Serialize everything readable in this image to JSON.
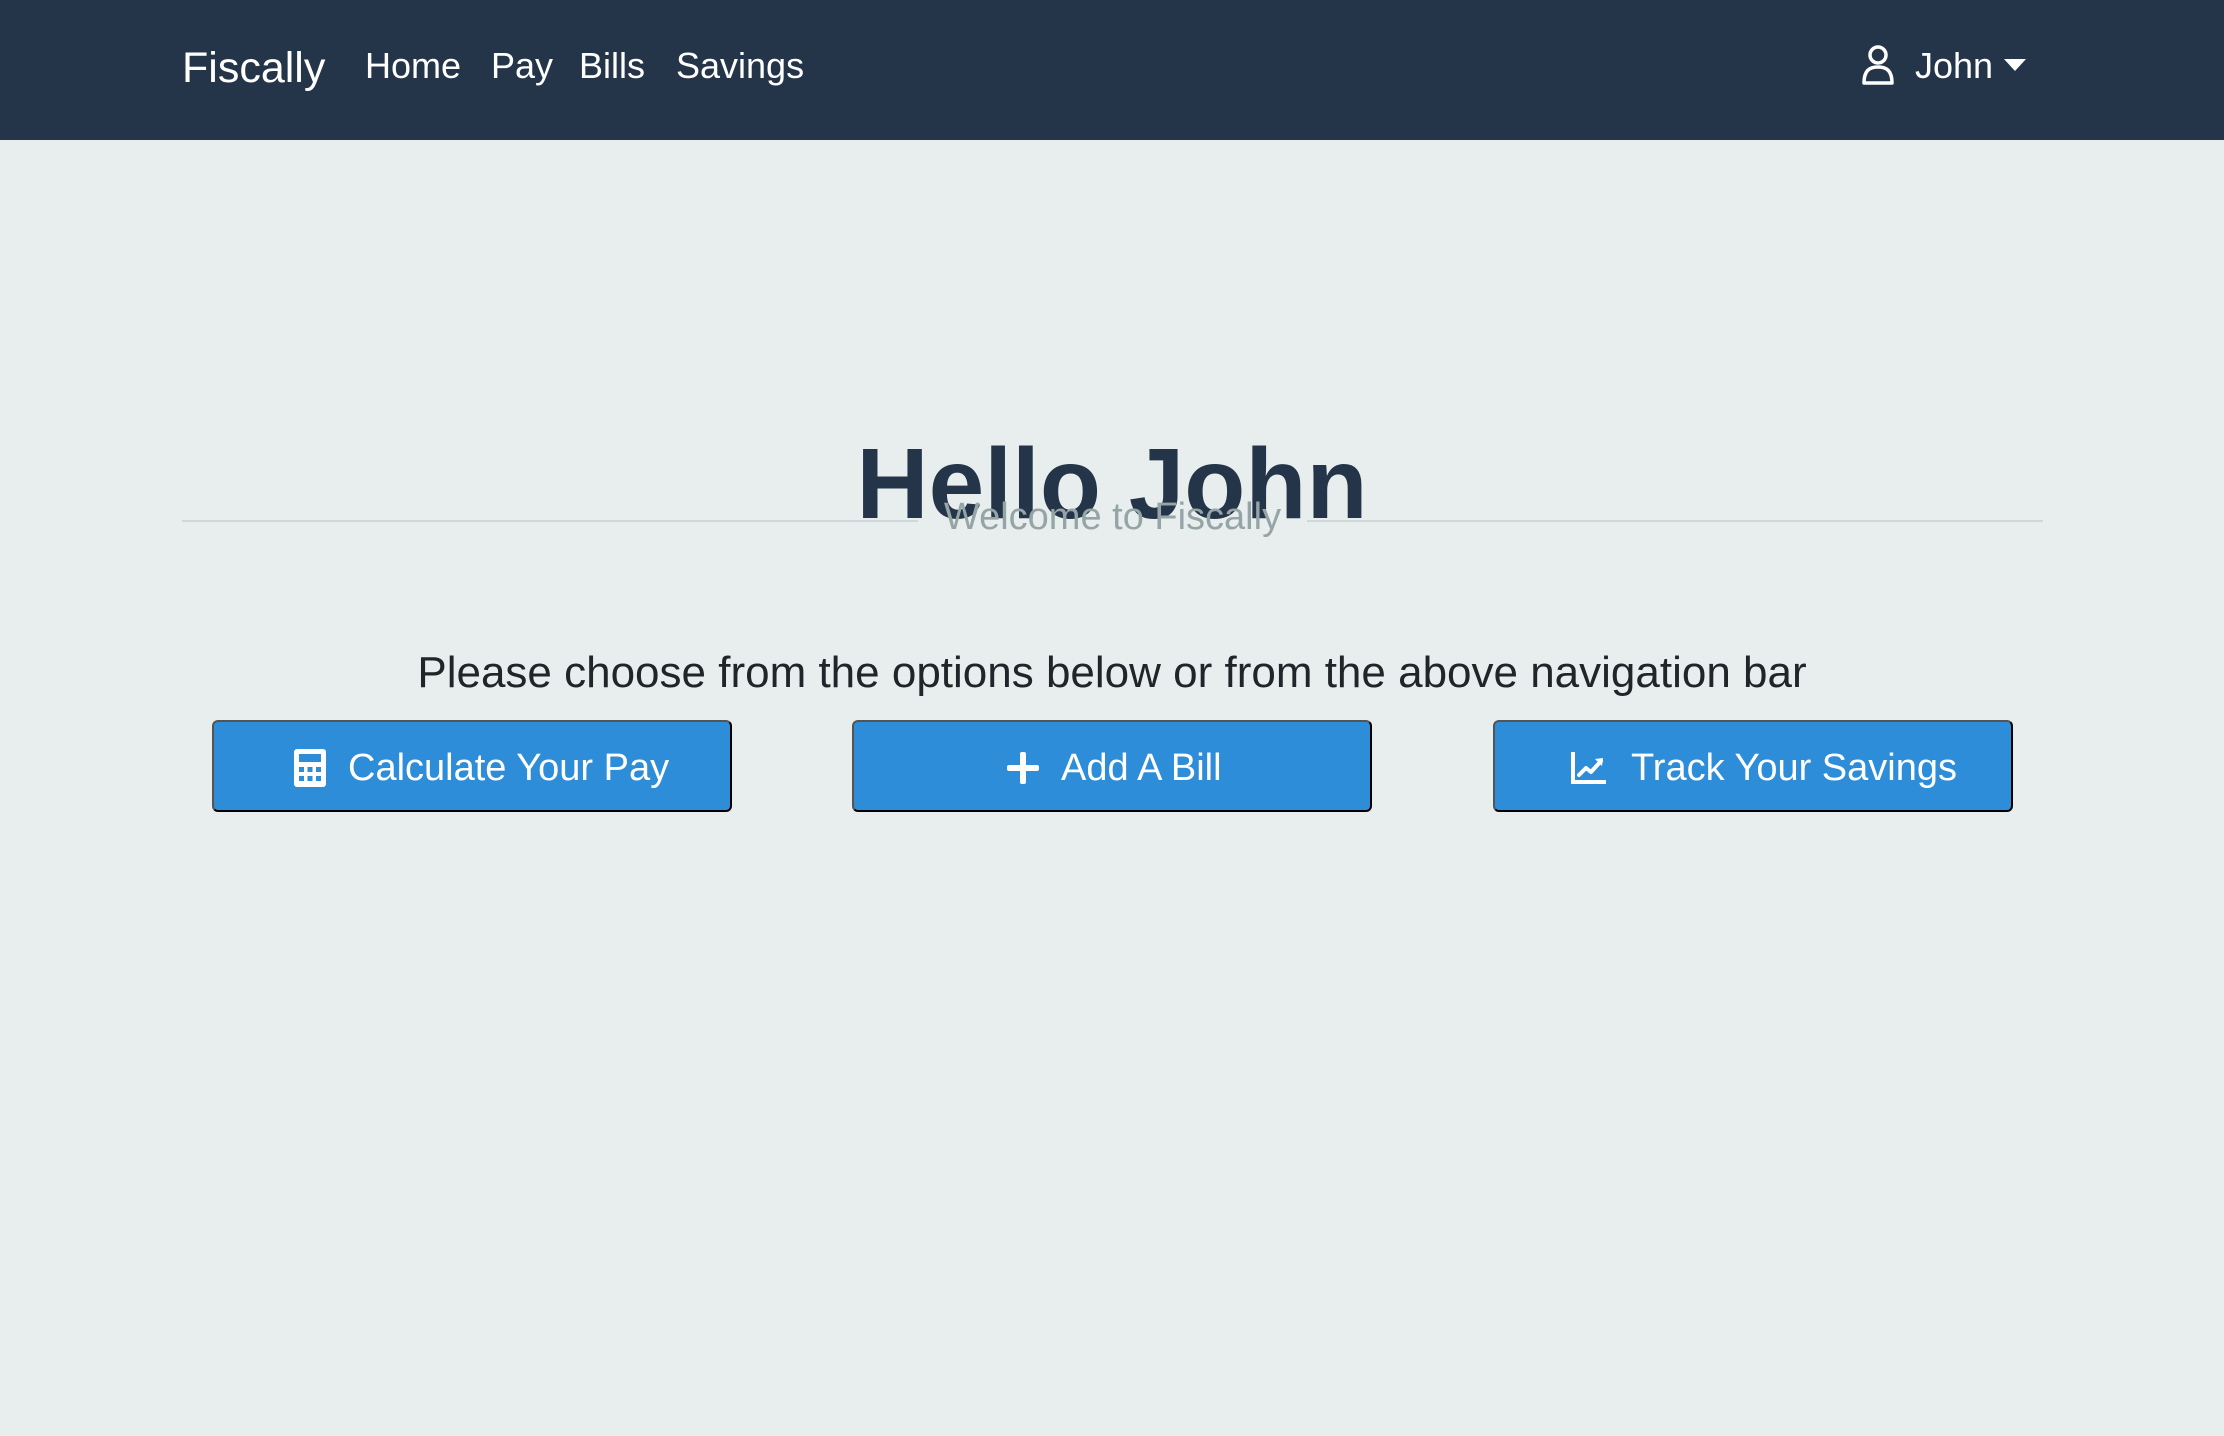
{
  "navbar": {
    "brand": "Fiscally",
    "links": [
      {
        "label": "Home"
      },
      {
        "label": "Pay"
      },
      {
        "label": "Bills"
      },
      {
        "label": "Savings"
      }
    ],
    "user": {
      "name": "John",
      "icon": "user-icon",
      "dropdown_icon": "caret-down-icon"
    }
  },
  "hero": {
    "title": "Hello John",
    "subtitle": "Welcome to Fiscally",
    "instructions": "Please choose from the options below or from the above navigation bar"
  },
  "actions": [
    {
      "label": "Calculate Your Pay",
      "icon": "calculator-icon"
    },
    {
      "label": "Add A Bill",
      "icon": "plus-icon"
    },
    {
      "label": "Track Your Savings",
      "icon": "chart-line-icon"
    }
  ],
  "colors": {
    "navbar_background": "#253549",
    "page_background": "#e8eeee",
    "button_primary": "#2d8dd9",
    "title_text": "#253549",
    "subtitle_text": "#95a5a6"
  }
}
